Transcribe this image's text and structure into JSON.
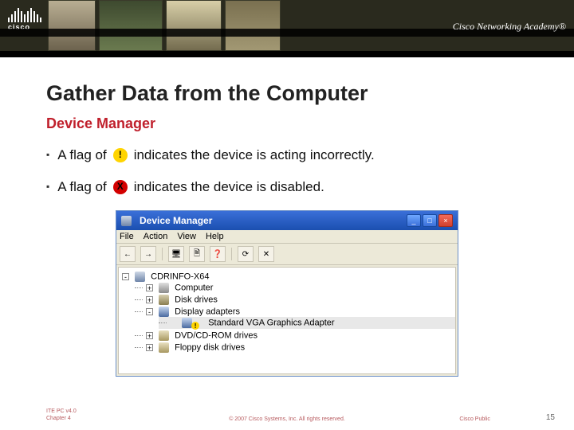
{
  "header": {
    "brand": "cisco",
    "academy": "Cisco Networking Academy®"
  },
  "title": "Gather Data from the Computer",
  "subtitle": "Device Manager",
  "bullets": [
    {
      "pre": "A flag of",
      "flag": "!",
      "flag_type": "yellow",
      "post": "indicates the device is acting incorrectly."
    },
    {
      "pre": "A flag of",
      "flag": "X",
      "flag_type": "red",
      "post": "indicates the device is disabled."
    }
  ],
  "dm": {
    "title": "Device Manager",
    "menu": [
      "File",
      "Action",
      "View",
      "Help"
    ],
    "toolbar_icons": [
      "←",
      "→",
      "🖥",
      "🗎",
      "❓",
      "⟳",
      "✕"
    ],
    "sys_icons": {
      "min": "_",
      "max": "□",
      "close": "×"
    },
    "root": "CDRINFO-X64",
    "nodes": [
      {
        "label": "Computer",
        "icon": "ic-comp",
        "expander": "+"
      },
      {
        "label": "Disk drives",
        "icon": "ic-disk",
        "expander": "+"
      },
      {
        "label": "Display adapters",
        "icon": "ic-disp",
        "expander": "-",
        "children": [
          {
            "label": "Standard VGA Graphics Adapter",
            "icon": "ic-vga",
            "warn": "!"
          }
        ]
      },
      {
        "label": "DVD/CD-ROM drives",
        "icon": "ic-dvd",
        "expander": "+"
      },
      {
        "label": "Floppy disk drives",
        "icon": "ic-flop",
        "expander": "+"
      }
    ]
  },
  "footer": {
    "left_line1": "ITE PC v4.0",
    "left_line2": "Chapter 4",
    "center": "© 2007 Cisco Systems, Inc. All rights reserved.",
    "public": "Cisco Public",
    "page": "15"
  }
}
